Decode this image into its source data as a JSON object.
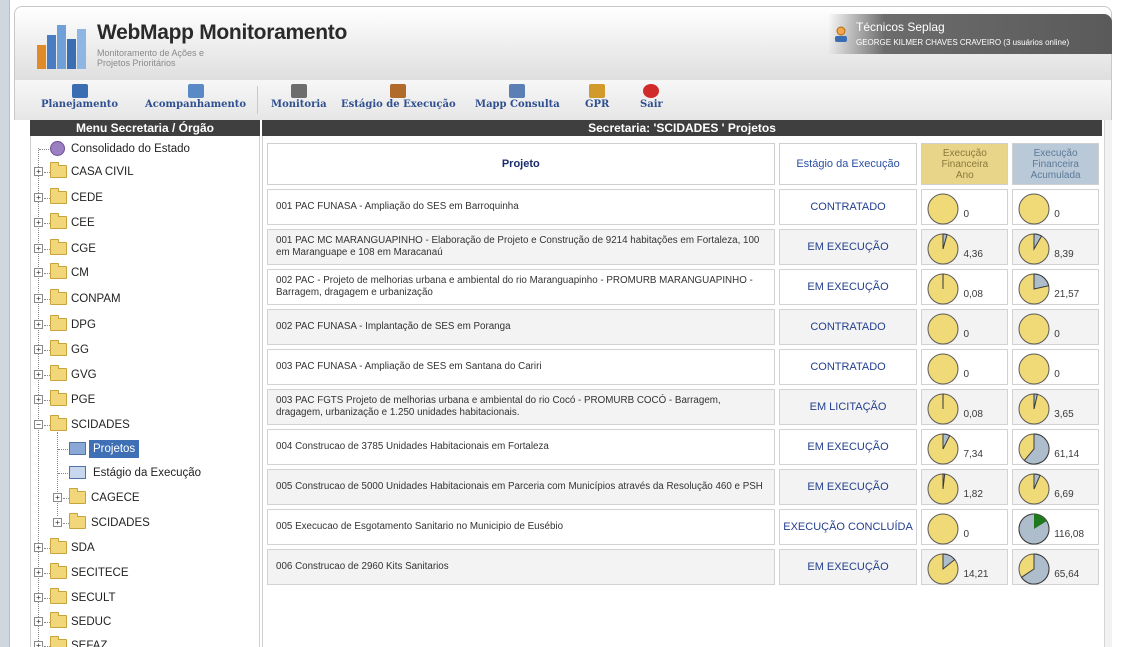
{
  "header": {
    "app_title": "WebMapp Monitoramento",
    "app_subtitle": "Monitoramento de Ações e Projetos Prioritários",
    "user_group": "Técnicos Seplag",
    "user_name": "GEORGE KILMER CHAVES CRAVEIRO (3 usuários online)"
  },
  "toolbar": {
    "items": [
      {
        "label": "Planejamento",
        "icon": "planning-icon",
        "color": "#3b6db3"
      },
      {
        "label": "Acompanhamento",
        "icon": "tracking-icon",
        "color": "#5a8ac6"
      },
      {
        "label": "Monitoria",
        "icon": "monitor-icon",
        "color": "#6d6d6d"
      },
      {
        "label": "Estágio de Execução",
        "icon": "stage-icon",
        "color": "#b06a2a"
      },
      {
        "label": "Mapp Consulta",
        "icon": "query-icon",
        "color": "#5b7fb5"
      },
      {
        "label": "GPR",
        "icon": "gpr-icon",
        "color": "#d19a2a"
      },
      {
        "label": "Sair",
        "icon": "exit-icon",
        "color": "#d12a2a"
      }
    ]
  },
  "menu": {
    "title": "Menu Secretaria / Órgão",
    "root": "Consolidado do Estado",
    "items": [
      "CASA CIVIL",
      "CEDE",
      "CEE",
      "CGE",
      "CM",
      "CONPAM",
      "DPG",
      "GG",
      "GVG",
      "PGE",
      "SCIDADES"
    ],
    "scidades_children": [
      "Projetos",
      "Estágio da Execução",
      "CAGECE",
      "SCIDADES"
    ],
    "items_after": [
      "SDA",
      "SECITECE",
      "SECULT",
      "SEDUC",
      "SEFAZ"
    ]
  },
  "panel": {
    "title": "Secretaria: 'SCIDADES ' Projetos",
    "col_project": "Projeto",
    "col_stage": "Estágio da Execução",
    "col_fin_line1": "Execução",
    "col_fin_line2": "Financeira",
    "col_fin_line3": "Ano",
    "col_acc_line1": "Execução",
    "col_acc_line2": "Financeira",
    "col_acc_line3": "Acumulada"
  },
  "rows": [
    {
      "project": "001 PAC FUNASA - Ampliação do SES em Barroquinha",
      "stage": "CONTRATADO",
      "fin_label": "0",
      "fin_pct": 0,
      "acc_label": "0",
      "acc_pct": 0
    },
    {
      "project": "001 PAC MC MARANGUAPINHO - Elaboração de Projeto e Construção de 9214 habitações em Fortaleza, 100 em Maranguape e 108 em Maracanaú",
      "stage": "EM EXECUÇÃO",
      "fin_label": "4,36",
      "fin_pct": 4.36,
      "acc_label": "8,39",
      "acc_pct": 8.39
    },
    {
      "project": "002 PAC - Projeto de melhorias urbana e ambiental do rio Maranguapinho - PROMURB MARANGUAPINHO - Barragem, dragagem e urbanização",
      "stage": "EM EXECUÇÃO",
      "fin_label": "0,08",
      "fin_pct": 0.08,
      "acc_label": "21,57",
      "acc_pct": 21.57
    },
    {
      "project": "002 PAC FUNASA - Implantação de SES em Poranga",
      "stage": "CONTRATADO",
      "fin_label": "0",
      "fin_pct": 0,
      "acc_label": "0",
      "acc_pct": 0
    },
    {
      "project": "003 PAC FUNASA - Ampliação de SES em Santana do Cariri",
      "stage": "CONTRATADO",
      "fin_label": "0",
      "fin_pct": 0,
      "acc_label": "0",
      "acc_pct": 0
    },
    {
      "project": "003 PAC FGTS Projeto de melhorias urbana e ambiental do rio Cocó - PROMURB COCÓ - Barragem, dragagem, urbanização e 1.250 unidades habitacionais.",
      "stage": "EM LICITAÇÃO",
      "fin_label": "0,08",
      "fin_pct": 0.08,
      "acc_label": "3,65",
      "acc_pct": 3.65
    },
    {
      "project": "004 Construcao de 3785 Unidades Habitacionais em Fortaleza",
      "stage": "EM EXECUÇÃO",
      "fin_label": "7,34",
      "fin_pct": 7.34,
      "acc_label": "61,14",
      "acc_pct": 61.14
    },
    {
      "project": "005 Construcao de 5000 Unidades Habitacionais em Parceria com Municípios através da Resolução 460 e PSH",
      "stage": "EM EXECUÇÃO",
      "fin_label": "1,82",
      "fin_pct": 1.82,
      "acc_label": "6,69",
      "acc_pct": 6.69
    },
    {
      "project": "005 Execucao de Esgotamento Sanitario no Municipio de Eusébio",
      "stage": "EXECUÇÃO CONCLUÍDA",
      "fin_label": "0",
      "fin_pct": 0,
      "acc_label": "116,08",
      "acc_pct": 116.08
    },
    {
      "project": "006 Construcao de 2960 Kits Sanitarios",
      "stage": "EM EXECUÇÃO",
      "fin_label": "14,21",
      "fin_pct": 14.21,
      "acc_label": "65,64",
      "acc_pct": 65.64
    }
  ],
  "colors": {
    "pie_fill": "#f0d977",
    "pie_filled": "#aebdcc",
    "pie_over": "#1f7a1f",
    "header_dark": "#3f3f3f",
    "stage_text": "#24408f"
  }
}
